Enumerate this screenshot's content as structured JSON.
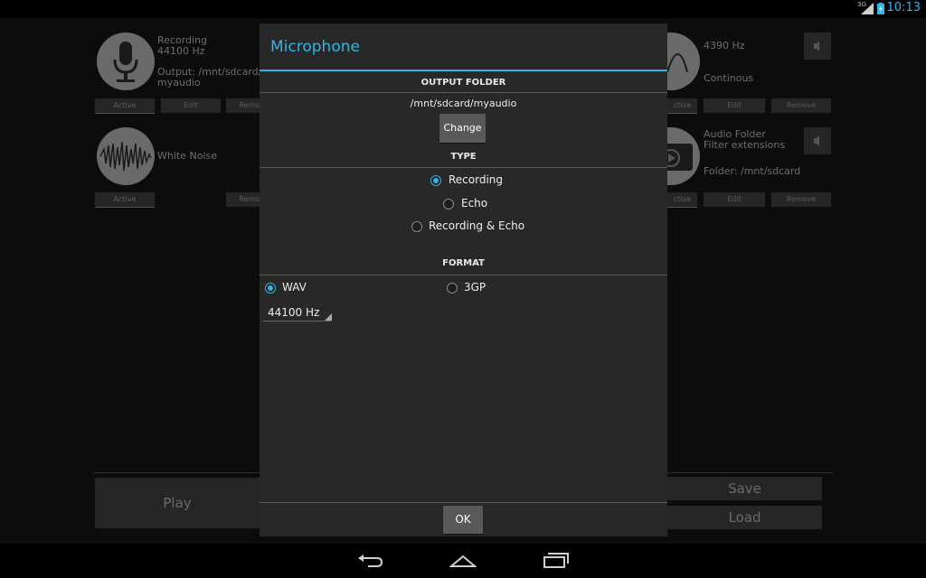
{
  "status_bar": {
    "time": "10:13",
    "network": "3G",
    "icons": [
      "signal-icon",
      "battery-icon"
    ]
  },
  "background": {
    "tiles": [
      {
        "lines": [
          "Recording",
          "44100 Hz",
          "",
          "Output: /mnt/sdcard/",
          "myaudio"
        ],
        "icon": "microphone-icon",
        "buttons": [
          "Active",
          "Edit",
          "Remo"
        ]
      },
      {
        "lines": [
          "White Noise"
        ],
        "icon": "waveform-icon",
        "buttons": [
          "Active",
          "Remo"
        ]
      },
      {
        "lines": [
          "4390 Hz",
          "",
          "",
          "Continous"
        ],
        "icon": "sine-wave-icon",
        "buttons": [
          "ctive",
          "Edit",
          "Remove"
        ]
      },
      {
        "lines": [
          "Audio Folder",
          "Filter extensions",
          "",
          "Folder: /mnt/sdcard"
        ],
        "icon": "folder-play-icon",
        "buttons": [
          "ctive",
          "Edit",
          "Remove"
        ]
      }
    ],
    "play_label": "Play",
    "save_label": "Save",
    "load_label": "Load",
    "volume_icon": "speaker-icon"
  },
  "dialog": {
    "title": "Microphone",
    "output_folder": {
      "heading": "OUTPUT FOLDER",
      "path": "/mnt/sdcard/myaudio",
      "change_label": "Change"
    },
    "type": {
      "heading": "TYPE",
      "options": [
        {
          "label": "Recording",
          "checked": true
        },
        {
          "label": "Echo",
          "checked": false
        },
        {
          "label": "Recording & Echo",
          "checked": false
        }
      ]
    },
    "format": {
      "heading": "FORMAT",
      "options": [
        {
          "label": "WAV",
          "checked": true
        },
        {
          "label": "3GP",
          "checked": false
        }
      ],
      "sample_rate": "44100 Hz"
    },
    "ok_label": "OK"
  },
  "colors": {
    "accent": "#33b5e5",
    "dialog_bg": "#282828",
    "backdrop": "#0c0c0c"
  }
}
